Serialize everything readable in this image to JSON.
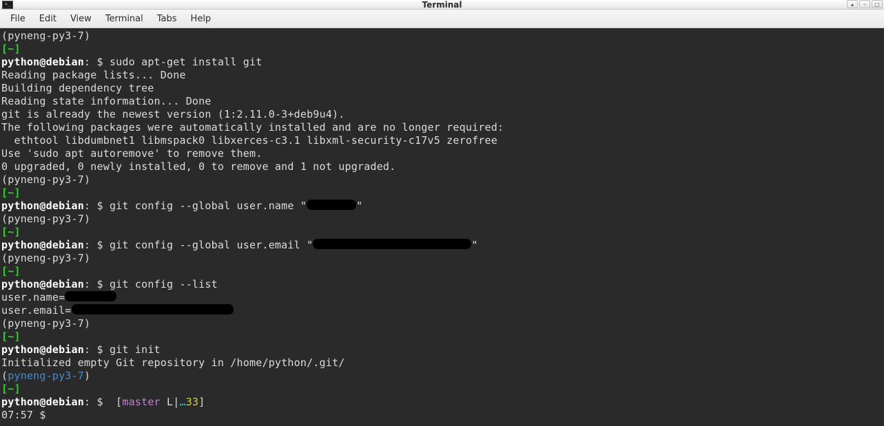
{
  "titlebar": {
    "icon_text": ">_",
    "title": "Terminal",
    "controls": {
      "roll": "▴",
      "min": "–",
      "max": "□"
    }
  },
  "menubar": {
    "items": [
      "File",
      "Edit",
      "View",
      "Terminal",
      "Tabs",
      "Help"
    ]
  },
  "term": {
    "venv": "(pyneng-py3-7)",
    "cwd": "[~]",
    "userhost": "python@debian",
    "prompt_sep": ": $ ",
    "cmd1": "sudo apt-get install git",
    "apt1": "Reading package lists... Done",
    "apt2": "Building dependency tree",
    "apt3": "Reading state information... Done",
    "apt4": "git is already the newest version (1:2.11.0-3+deb9u4).",
    "apt5": "The following packages were automatically installed and are no longer required:",
    "apt6": "  ethtool libdumbnet1 libmspack0 libxerces-c3.1 libxml-security-c17v5 zerofree",
    "apt7": "Use 'sudo apt autoremove' to remove them.",
    "apt8": "0 upgraded, 0 newly installed, 0 to remove and 1 not upgraded.",
    "cmd2_pre": "git config --global user.name \"",
    "cmd2_post": "\"",
    "cmd3_pre": "git config --global user.email \"",
    "cmd3_post": "\"",
    "cmd4": "git config --list",
    "list1": "user.name=",
    "list2": "user.email=",
    "cmd5": "git init",
    "init1": "Initialized empty Git repository in /home/python/.git/",
    "venv_open": "(",
    "venv_inner": "pyneng-py3-7",
    "venv_close": ")",
    "branch_open": "[",
    "branch": "master",
    "branch_mid": " L|",
    "branch_ell": "…",
    "branch_num": "33",
    "branch_close": "]",
    "time_prompt": "07:57 $ ",
    "space": " "
  }
}
